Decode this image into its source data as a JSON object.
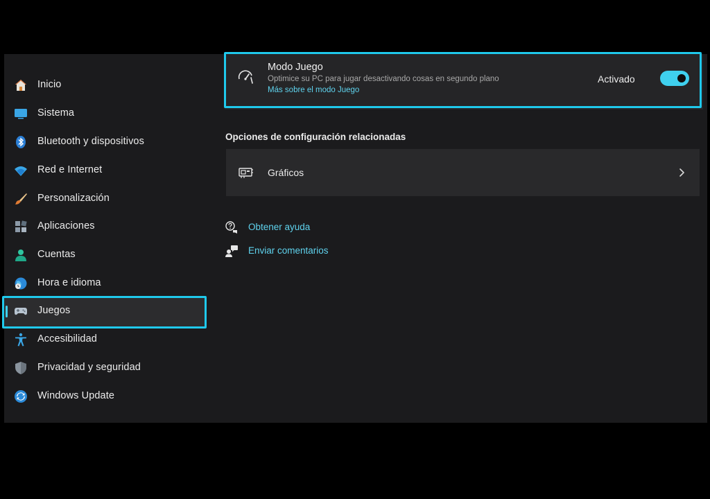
{
  "sidebar": {
    "items": [
      {
        "label": "Inicio"
      },
      {
        "label": "Sistema"
      },
      {
        "label": "Bluetooth y dispositivos"
      },
      {
        "label": "Red e Internet"
      },
      {
        "label": "Personalización"
      },
      {
        "label": "Aplicaciones"
      },
      {
        "label": "Cuentas"
      },
      {
        "label": "Hora e idioma"
      },
      {
        "label": "Juegos"
      },
      {
        "label": "Accesibilidad"
      },
      {
        "label": "Privacidad y seguridad"
      },
      {
        "label": "Windows Update"
      }
    ],
    "selected": "Juegos"
  },
  "game_mode": {
    "title": "Modo Juego",
    "description": "Optimice su PC para jugar desactivando cosas en segundo plano",
    "link": "Más sobre el modo Juego",
    "status": "Activado",
    "enabled": true
  },
  "related": {
    "heading": "Opciones de configuración relacionadas",
    "graphics_label": "Gráficos"
  },
  "help": {
    "get_help": "Obtener ayuda",
    "send_feedback": "Enviar comentarios"
  },
  "colors": {
    "accent": "#3fd0ee",
    "highlight": "#1fc9ec",
    "background": "#1b1b1d"
  }
}
